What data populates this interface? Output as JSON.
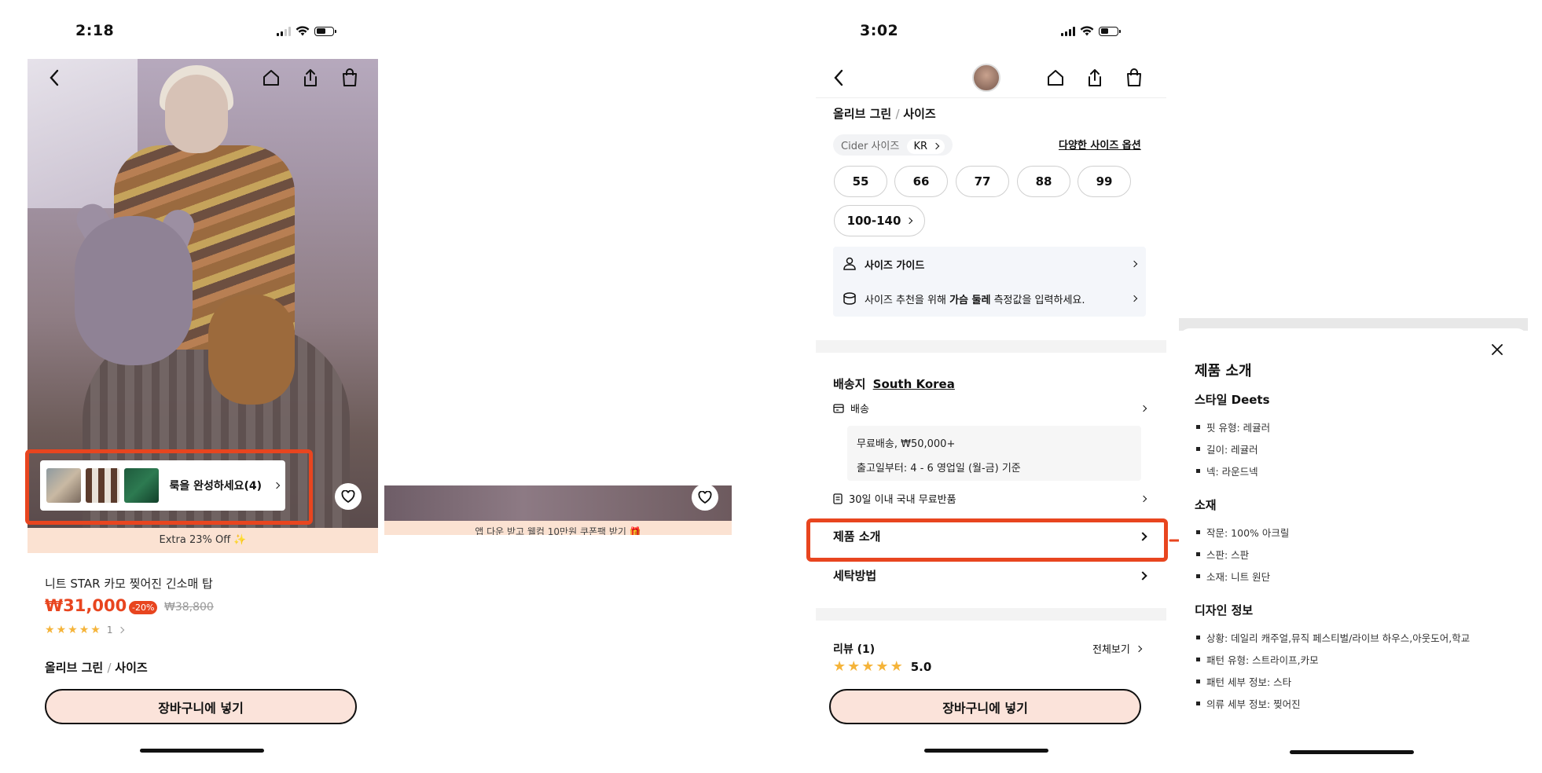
{
  "left_screen": {
    "status_time": "2:18",
    "look_card_label": "룩을 완성하세요(4)",
    "promo_text": "Extra 23% Off ✨",
    "product_name": "니트 STAR 카모 찢어진 긴소매 탑",
    "price": "₩31,000",
    "discount": "-20%",
    "original_price": "₩38,800",
    "rating_stars": 5,
    "review_count": "1",
    "selected_color": "올리브 그린",
    "size_label": "사이즈",
    "cart_button": "장바구니에 넣기"
  },
  "middle_screen": {
    "promo_text": "앱 다운 받고 웰컴 10만원 쿠폰팩 받기 🎁"
  },
  "right_screen": {
    "status_time": "3:02",
    "selected_color": "올리브 그린",
    "size_label": "사이즈",
    "cider_size": "Cider 사이즈",
    "region": "KR",
    "size_options_link": "다양한 사이즈 옵션",
    "sizes": [
      "55",
      "66",
      "77",
      "88",
      "99"
    ],
    "size_extended": "100-140",
    "size_guide": "사이즈 가이드",
    "size_reco_pre": "사이즈 추천을 위해 ",
    "size_reco_bold": "가슴 둘레",
    "size_reco_post": " 측정값을 입력하세요.",
    "ship_to_label": "배송지",
    "ship_to_country": "South Korea",
    "shipping_label": "배송",
    "free_shipping": "무료배송, ₩50,000+",
    "ship_time": "출고일부터: 4 - 6 영업일 (월-금) 기준",
    "returns": "30일 이내 국내 무료반품",
    "product_intro": "제품 소개",
    "wash": "세탁방법",
    "reviews_label": "리뷰 (1)",
    "see_all": "전체보기",
    "rating": "5.0",
    "cart_button": "장바구니에 넣기"
  },
  "panel": {
    "title": "제품 소개",
    "sections": [
      {
        "heading": "스타일 Deets",
        "items": [
          "핏 유형: 레귤러",
          "길이: 레귤러",
          "넥: 라운드넥"
        ]
      },
      {
        "heading": "소재",
        "items": [
          "작문: 100% 아크릴",
          "스판: 스판",
          "소재: 니트 원단"
        ]
      },
      {
        "heading": "디자인 정보",
        "items": [
          "상황: 데일리 캐주얼,뮤직 페스티벌/라이브 하우스,아웃도어,학교",
          "패턴 유형: 스트라이프,카모",
          "패턴 세부 정보: 스타",
          "의류 세부 정보: 찢어진"
        ]
      }
    ]
  },
  "colors": {
    "accent": "#e8451f",
    "cart_bg": "#fbe3da",
    "star": "#f5b43a"
  }
}
